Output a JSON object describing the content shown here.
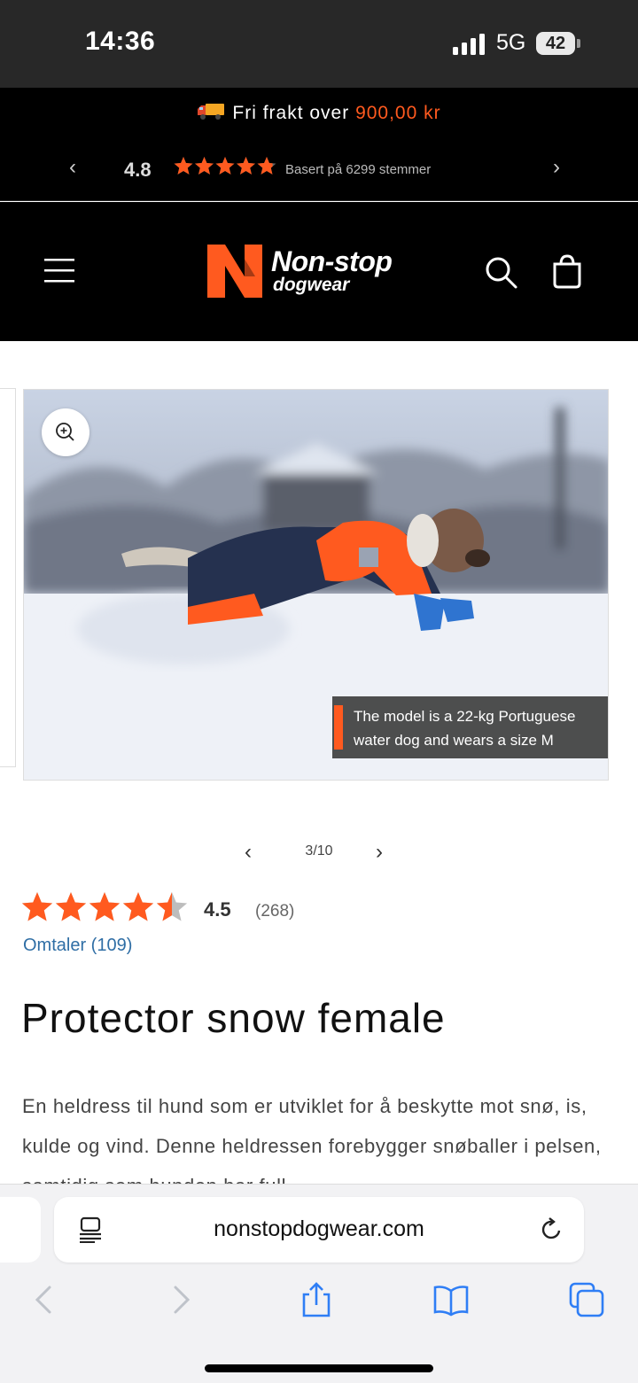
{
  "status_bar": {
    "time": "14:36",
    "network": "5G",
    "battery": "42"
  },
  "promo": {
    "shipping_prefix": "Fri frakt over ",
    "shipping_amount": "900,00 kr",
    "store_rating": "4.8",
    "store_votes": "Basert på 6299 stemmer",
    "prev_icon": "chevron-left-icon",
    "next_icon": "chevron-right-icon"
  },
  "header": {
    "logo_line1": "Non-stop",
    "logo_line2": "dogwear",
    "brand_color": "#ff5a1f"
  },
  "gallery": {
    "caption": "The model is a 22-kg Portuguese water dog and wears a size M",
    "counter": "3/10"
  },
  "product": {
    "rating": "4.5",
    "rating_value": 4.5,
    "rating_count": "(268)",
    "reviews_link": "Omtaler (109)",
    "title": "Protector snow female",
    "description": "En heldress til hund som er utviklet for å beskytte mot snø, is, kulde og vind. Denne heldressen forebygger snøballer i pelsen, samtidig som hunden har full"
  },
  "browser": {
    "url": "nonstopdogwear.com",
    "toolbar_icons": [
      "back-icon",
      "forward-icon",
      "share-icon",
      "bookmarks-icon",
      "tabs-icon"
    ]
  }
}
